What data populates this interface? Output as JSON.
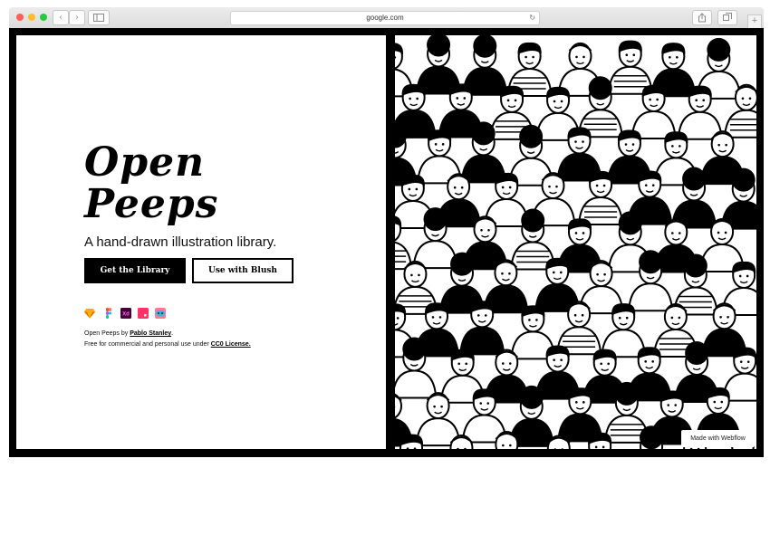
{
  "browser": {
    "url": "google.com",
    "back_glyph": "‹",
    "forward_glyph": "›",
    "reload_glyph": "↻",
    "new_tab_glyph": "+"
  },
  "hero": {
    "title_line1": "Open",
    "title_line2": "Peeps",
    "subtitle": "A hand-drawn illustration library.",
    "primary_button": "Get the Library",
    "secondary_button": "Use with Blush",
    "tool_icons": [
      "sketch-icon",
      "figma-icon",
      "adobe-xd-icon",
      "invision-studio-icon",
      "blush-icon"
    ],
    "xd_label": "Xd",
    "credit_prefix": "Open Peeps by ",
    "author": "Pablo Stanley",
    "credit_suffix": ".",
    "license_prefix": "Free for commercial and personal use under ",
    "license": "CC0 License."
  },
  "badge": "Made with Webflow",
  "colors": {
    "background": "#000000",
    "accent": "#000000",
    "traffic_red": "#fc5f57",
    "traffic_yellow": "#fdbc2e",
    "traffic_green": "#28c840"
  }
}
